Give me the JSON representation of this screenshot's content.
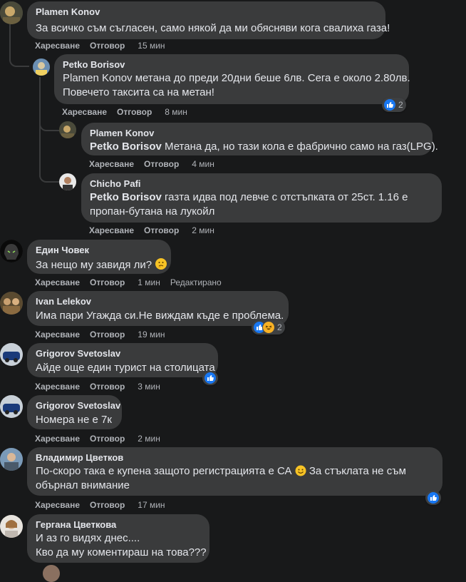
{
  "labels": {
    "like": "Харесване",
    "reply": "Отговор",
    "edited": "Редактирано"
  },
  "comments": [
    {
      "author": "Plamen Konov",
      "text": "За всичко съм съгласен, само някой да ми обясняви кога свалиха газа!",
      "time": "15 мин"
    },
    {
      "author": "Petko Borisov",
      "line1": "Plamen Konov метана до преди 20дни беше 6лв. Сега е около 2.80лв.",
      "line2": "Повечето таксита са на метан!",
      "time": "8 мин",
      "reactions": "2"
    },
    {
      "author": "Plamen Konov",
      "mention": "Petko Borisov",
      "text": " Метана да, но тази кола е фабрично само на газ(LPG).",
      "time": "4 мин"
    },
    {
      "author": "Chicho Pafi",
      "mention": "Petko Borisov",
      "line1": " газта идва под левче с отстъпката от 25ст. 1.16 е",
      "line2": "пропан-бутана на лукойл",
      "time": "2 мин"
    },
    {
      "author": "Един Човек",
      "text": "За нещо му завидя ли?",
      "time": "1 мин"
    },
    {
      "author": "Ivan Lelekov",
      "text": "Има пари Угажда си.Не виждам къде е проблема.",
      "time": "19 мин",
      "reactions": "2"
    },
    {
      "author": "Grigorov Svetoslav",
      "text": "Айде още един турист на столицата",
      "time": "3 мин"
    },
    {
      "author": "Grigorov Svetoslav",
      "text": "Номера не е 7к",
      "time": "2 мин"
    },
    {
      "author": "Владимир Цветков",
      "line1": "По-скоро така е купена защото регистрацията е СА",
      "line1b": "За стъклата не съм",
      "line2": "обърнал внимание",
      "time": "17 мин"
    },
    {
      "author": "Гергана Цветкова",
      "line1": "И аз го видях днес....",
      "line2": "Кво да му коментираш на това???"
    }
  ],
  "colors": {
    "background": "#18191a",
    "bubble": "#3a3b3c",
    "text": "#e4e6eb",
    "muted": "#b0b3b8",
    "like": "#1877f2",
    "haha": "#f7b125"
  }
}
